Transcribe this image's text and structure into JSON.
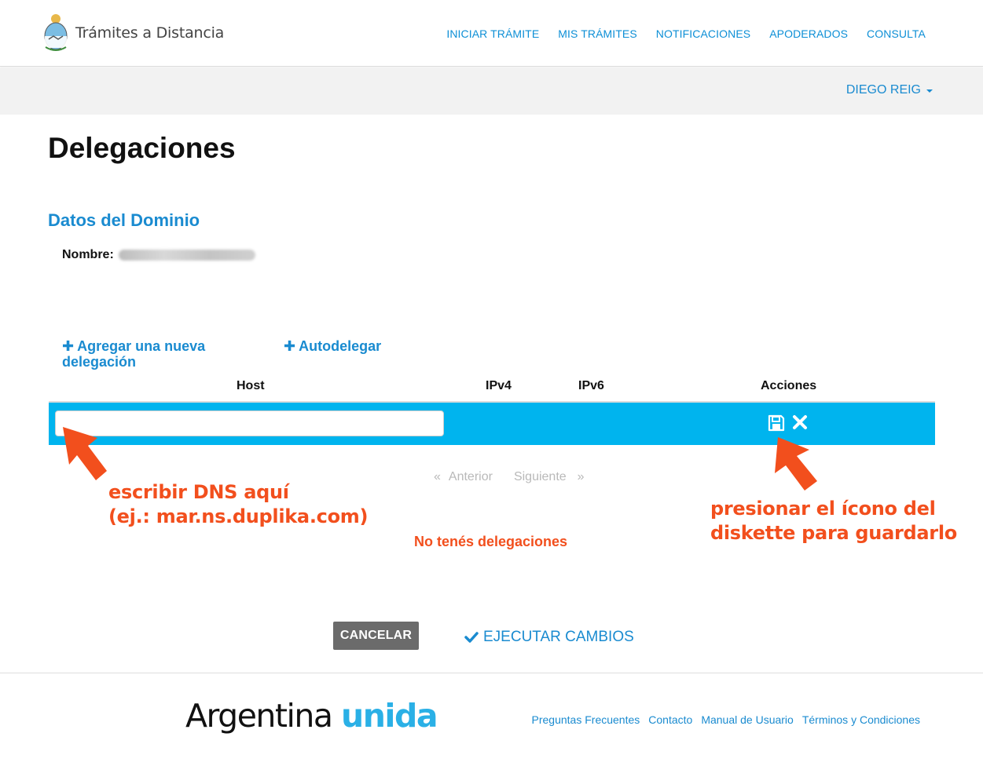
{
  "header": {
    "app_title": "Trámites a Distancia",
    "nav": [
      "INICIAR TRÁMITE",
      "MIS TRÁMITES",
      "NOTIFICACIONES",
      "APODERADOS",
      "CONSULTA"
    ],
    "user_name": "DIEGO REIG"
  },
  "page": {
    "title": "Delegaciones",
    "section_title": "Datos del Dominio",
    "nombre_label": "Nombre:"
  },
  "actions": {
    "add_delegation": "Agregar una nueva delegación",
    "autodelegate": "Autodelegar"
  },
  "table": {
    "columns": [
      "Host",
      "IPv4",
      "IPv6",
      "Acciones"
    ],
    "host_input_value": ""
  },
  "pagination": {
    "prev_symbol": "«",
    "prev": "Anterior",
    "next": "Siguiente",
    "next_symbol": "»"
  },
  "annotations": {
    "left_line1": "escribir DNS aquí",
    "left_line2": "(ej.: mar.ns.duplika.com)",
    "right_line1": "presionar el ícono del",
    "right_line2": "diskette para guardarlo"
  },
  "empty_message": "No tenés delegaciones",
  "buttons": {
    "cancel": "CANCELAR",
    "execute": "EJECUTAR CAMBIOS"
  },
  "footer": {
    "brand_part1": "Argentina",
    "brand_part2": "unida",
    "links": [
      "Preguntas Frecuentes",
      "Contacto",
      "Manual de Usuario",
      "Términos y Condiciones"
    ]
  },
  "colors": {
    "accent_blue": "#1a8bd0",
    "row_highlight": "#00b4ee",
    "annotation_orange": "#f24f1d",
    "brand_blue": "#2ab0e6"
  },
  "icons": [
    "argentina-seal-icon",
    "plus-icon",
    "floppy-disk-icon",
    "close-icon",
    "check-icon",
    "arrow-pointer-icon"
  ]
}
